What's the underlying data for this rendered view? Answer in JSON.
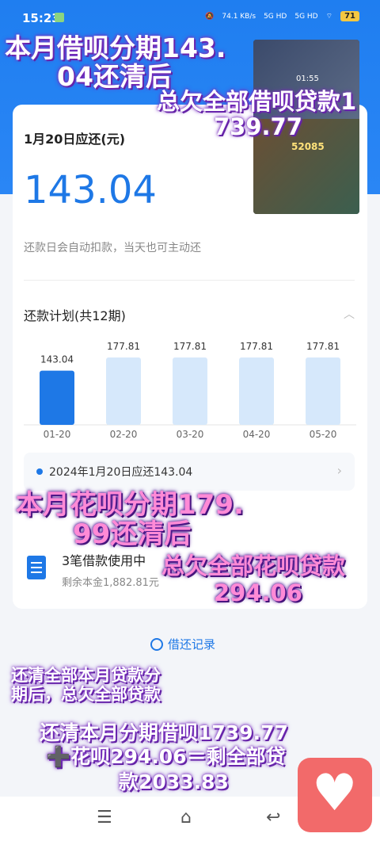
{
  "status": {
    "time": "15:23",
    "net1": "74.1 KB/s",
    "net2": "5G HD",
    "net3": "5G HD",
    "battery": "71"
  },
  "bill": {
    "due_label": "1月20日应还(元)",
    "amount": "143.04",
    "note": "还款日会自动扣款，当天也可主动还",
    "plan_title": "还款计划(共12期)",
    "detail_text": "2024年1月20日应还143.04"
  },
  "chart_data": {
    "type": "bar",
    "categories": [
      "01-20",
      "02-20",
      "03-20",
      "04-20",
      "05-20"
    ],
    "values": [
      143.04,
      177.81,
      177.81,
      177.81,
      177.81
    ],
    "ylim": [
      0,
      177.81
    ],
    "colors": {
      "current": "#1e78e6",
      "future": "#d6e8fb"
    }
  },
  "loans": {
    "title": "3笔借款使用中",
    "sub": "剩余本金1,882.81元"
  },
  "records_label": "借还记录",
  "overlays": {
    "t1": "本月借呗分期143.",
    "t2": "04还清后",
    "t3": "总欠全部借呗贷款1",
    "t4": "739.77",
    "t5": "本月花呗分期179.",
    "t6": "99还清后",
    "t7": "总欠全部花呗贷款",
    "t8": "294.06",
    "t9": "还清全部本月贷款分",
    "t10": "期后，总欠全部贷款",
    "t11": "还清本月分期借呗1739.77",
    "t12": "➕花呗294.06＝剩全部贷",
    "t13": "款2033.83"
  },
  "game_inset": {
    "score": "52085",
    "time": "01:55"
  },
  "colors": {
    "primary": "#1e78e6",
    "hero": "#2a86f5",
    "overlay_text": "#ffffff",
    "overlay_pink": "#ff8ad6"
  }
}
